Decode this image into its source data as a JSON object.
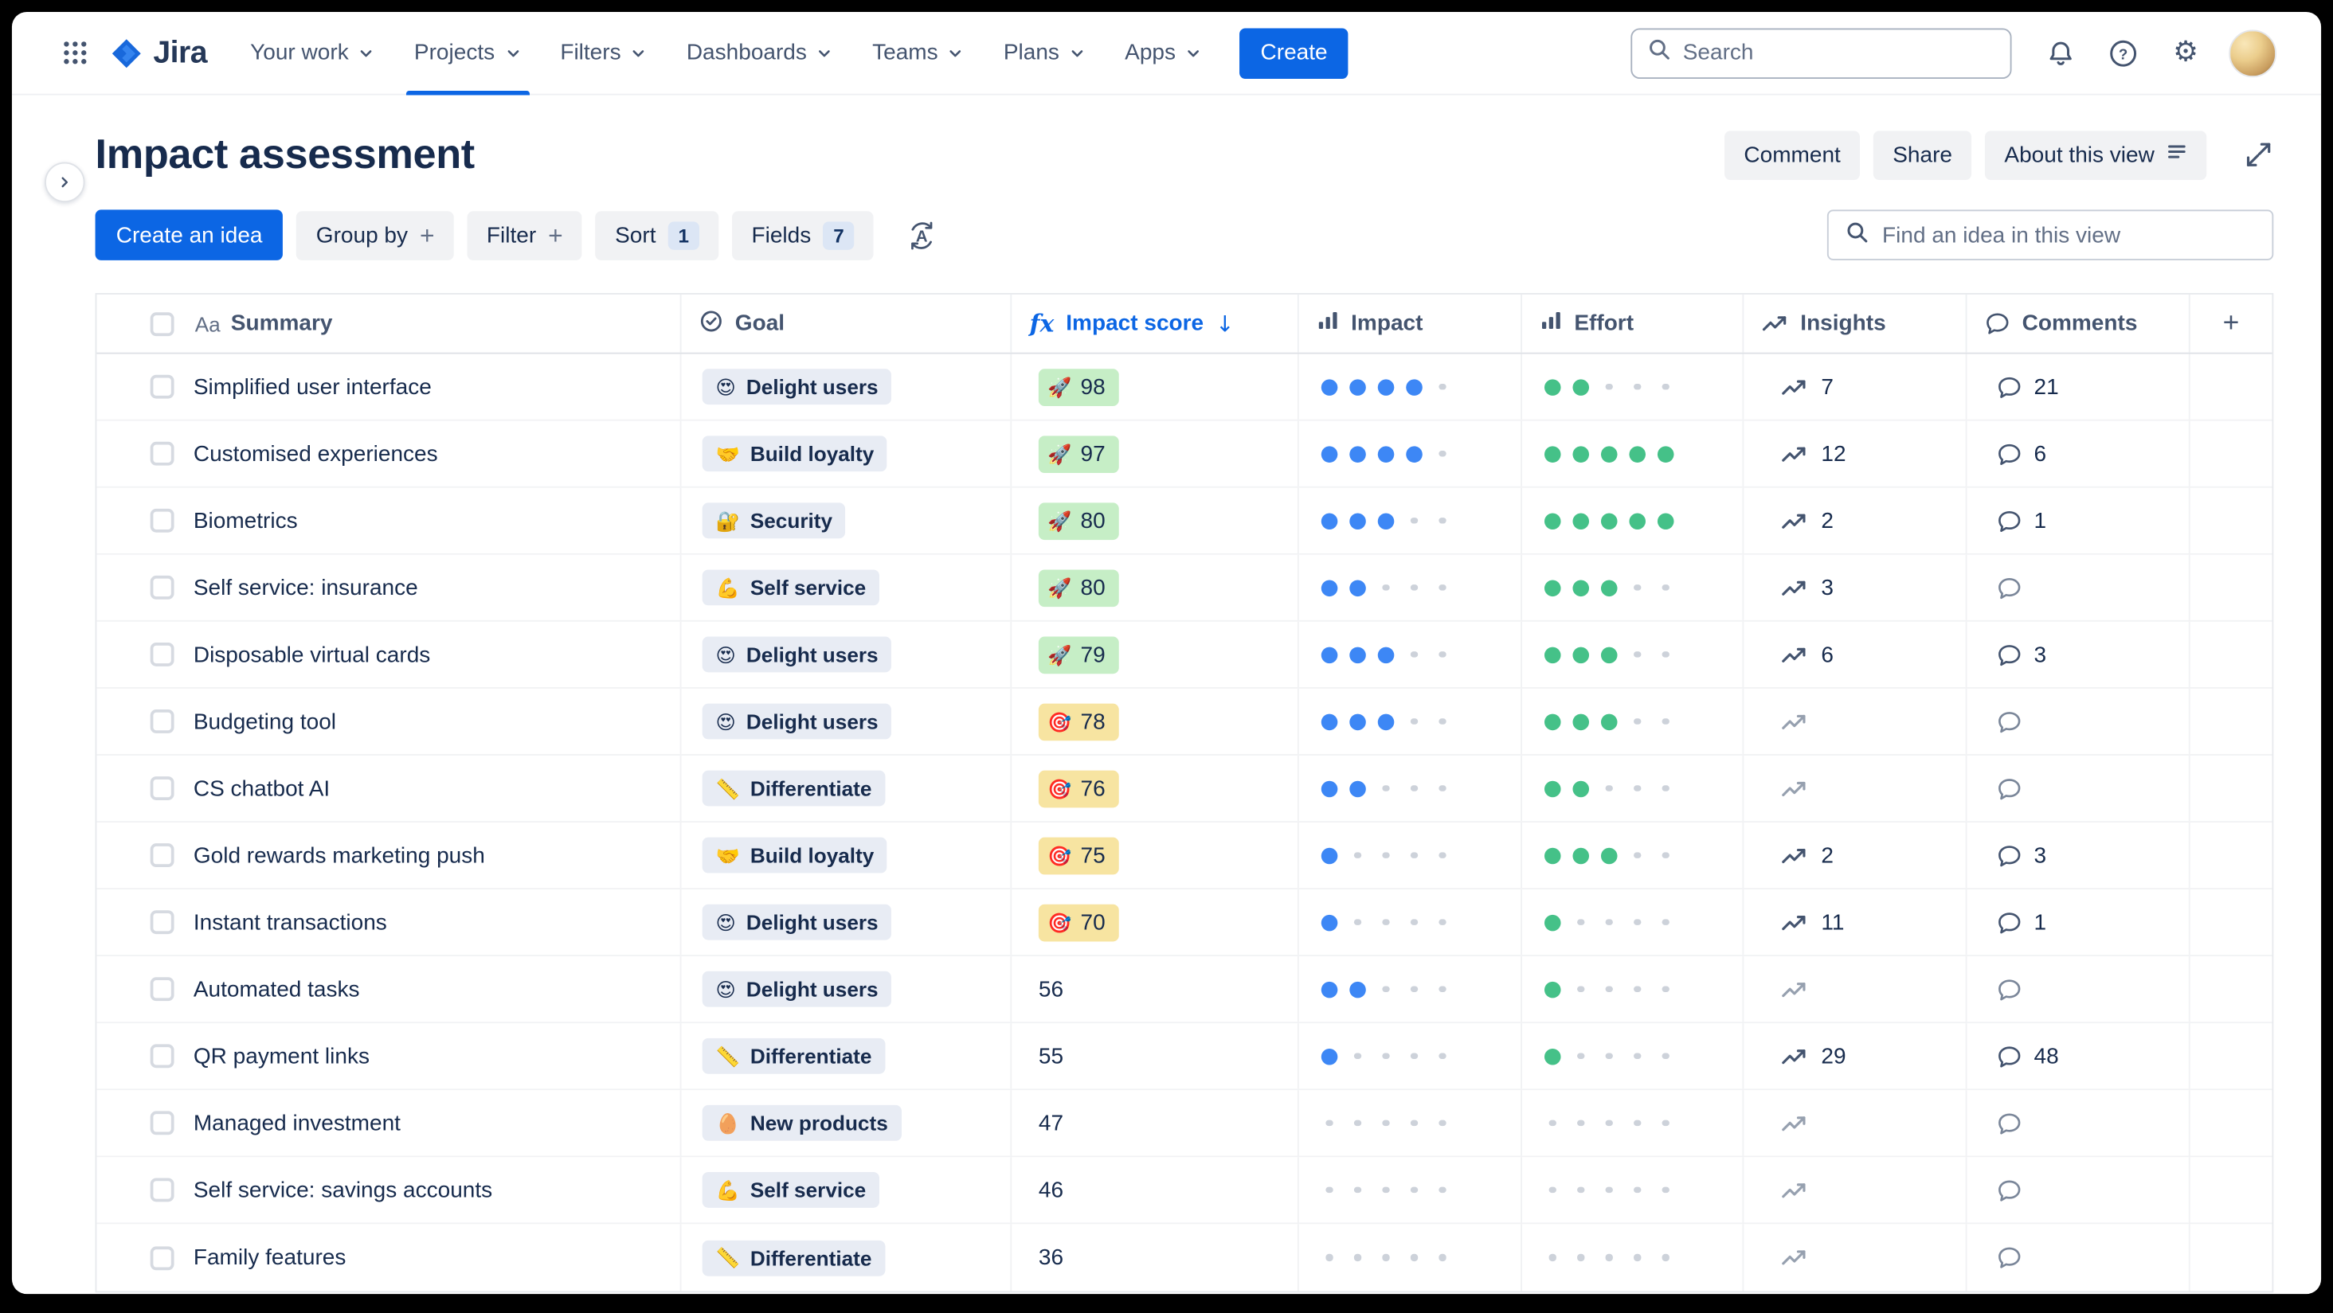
{
  "nav": {
    "logo": "Jira",
    "items": [
      "Your work",
      "Projects",
      "Filters",
      "Dashboards",
      "Teams",
      "Plans",
      "Apps"
    ],
    "active_item": "Projects",
    "create_label": "Create",
    "search_placeholder": "Search"
  },
  "header": {
    "title": "Impact assessment",
    "comment": "Comment",
    "share": "Share",
    "about": "About this view"
  },
  "toolbar": {
    "create_idea": "Create an idea",
    "group_by": "Group by",
    "filter": "Filter",
    "sort": "Sort",
    "sort_count": "1",
    "fields": "Fields",
    "fields_count": "7",
    "find_placeholder": "Find an idea in this view"
  },
  "icons": {
    "aa": "Aa",
    "fx": "fx",
    "sort_arrow": "↓",
    "plus": "+",
    "gear": "⚙"
  },
  "table": {
    "columns": [
      {
        "label": "Summary"
      },
      {
        "label": "Goal"
      },
      {
        "label": "Impact score",
        "sort": "desc"
      },
      {
        "label": "Impact"
      },
      {
        "label": "Effort"
      },
      {
        "label": "Insights"
      },
      {
        "label": "Comments"
      }
    ],
    "add_column": "+",
    "rows": [
      {
        "summary": "Simplified user interface",
        "goal": "Delight users",
        "goal_emoji": "😍",
        "score": "98",
        "score_tier": "green",
        "score_emoji": "🚀",
        "impact": 4,
        "effort": 2,
        "insights": "7",
        "comments": "21"
      },
      {
        "summary": "Customised experiences",
        "goal": "Build loyalty",
        "goal_emoji": "🤝",
        "score": "97",
        "score_tier": "green",
        "score_emoji": "🚀",
        "impact": 4,
        "effort": 5,
        "insights": "12",
        "comments": "6"
      },
      {
        "summary": "Biometrics",
        "goal": "Security",
        "goal_emoji": "🔐",
        "score": "80",
        "score_tier": "green",
        "score_emoji": "🚀",
        "impact": 3,
        "effort": 5,
        "insights": "2",
        "comments": "1"
      },
      {
        "summary": "Self service: insurance",
        "goal": "Self service",
        "goal_emoji": "💪",
        "score": "80",
        "score_tier": "green",
        "score_emoji": "🚀",
        "impact": 2,
        "effort": 3,
        "insights": "3",
        "comments": ""
      },
      {
        "summary": "Disposable virtual cards",
        "goal": "Delight users",
        "goal_emoji": "😍",
        "score": "79",
        "score_tier": "green",
        "score_emoji": "🚀",
        "impact": 3,
        "effort": 3,
        "insights": "6",
        "comments": "3"
      },
      {
        "summary": "Budgeting tool",
        "goal": "Delight users",
        "goal_emoji": "😍",
        "score": "78",
        "score_tier": "yellow",
        "score_emoji": "🎯",
        "impact": 3,
        "effort": 3,
        "insights": "",
        "comments": ""
      },
      {
        "summary": "CS chatbot AI",
        "goal": "Differentiate",
        "goal_emoji": "📏",
        "score": "76",
        "score_tier": "yellow",
        "score_emoji": "🎯",
        "impact": 2,
        "effort": 2,
        "insights": "",
        "comments": ""
      },
      {
        "summary": "Gold rewards marketing push",
        "goal": "Build loyalty",
        "goal_emoji": "🤝",
        "score": "75",
        "score_tier": "yellow",
        "score_emoji": "🎯",
        "impact": 1,
        "effort": 3,
        "insights": "2",
        "comments": "3"
      },
      {
        "summary": "Instant transactions",
        "goal": "Delight users",
        "goal_emoji": "😍",
        "score": "70",
        "score_tier": "yellow",
        "score_emoji": "🎯",
        "impact": 1,
        "effort": 1,
        "insights": "11",
        "comments": "1"
      },
      {
        "summary": "Automated tasks",
        "goal": "Delight users",
        "goal_emoji": "😍",
        "score": "56",
        "score_tier": "none",
        "score_emoji": "",
        "impact": 2,
        "effort": 1,
        "insights": "",
        "comments": ""
      },
      {
        "summary": "QR payment links",
        "goal": "Differentiate",
        "goal_emoji": "📏",
        "score": "55",
        "score_tier": "none",
        "score_emoji": "",
        "impact": 1,
        "effort": 1,
        "insights": "29",
        "comments": "48"
      },
      {
        "summary": "Managed investment",
        "goal": "New products",
        "goal_emoji": "🥚",
        "score": "47",
        "score_tier": "none",
        "score_emoji": "",
        "impact": 0,
        "effort": 0,
        "insights": "",
        "comments": ""
      },
      {
        "summary": "Self service: savings accounts",
        "goal": "Self service",
        "goal_emoji": "💪",
        "score": "46",
        "score_tier": "none",
        "score_emoji": "",
        "impact": 0,
        "effort": 0,
        "insights": "",
        "comments": ""
      },
      {
        "summary": "Family features",
        "goal": "Differentiate",
        "goal_emoji": "📏",
        "score": "36",
        "score_tier": "none",
        "score_emoji": "",
        "impact": 0,
        "effort": 0,
        "insights": "",
        "comments": ""
      }
    ]
  },
  "colors": {
    "brand_blue": "#0C66E4",
    "impact_dot": "#3D87F5",
    "effort_dot": "#45C188",
    "badge_green": "#C6EEC6",
    "badge_yellow": "#F7E4A1",
    "goal_chip": "#E8ECF4",
    "count_chip": "#DCE6F5"
  }
}
